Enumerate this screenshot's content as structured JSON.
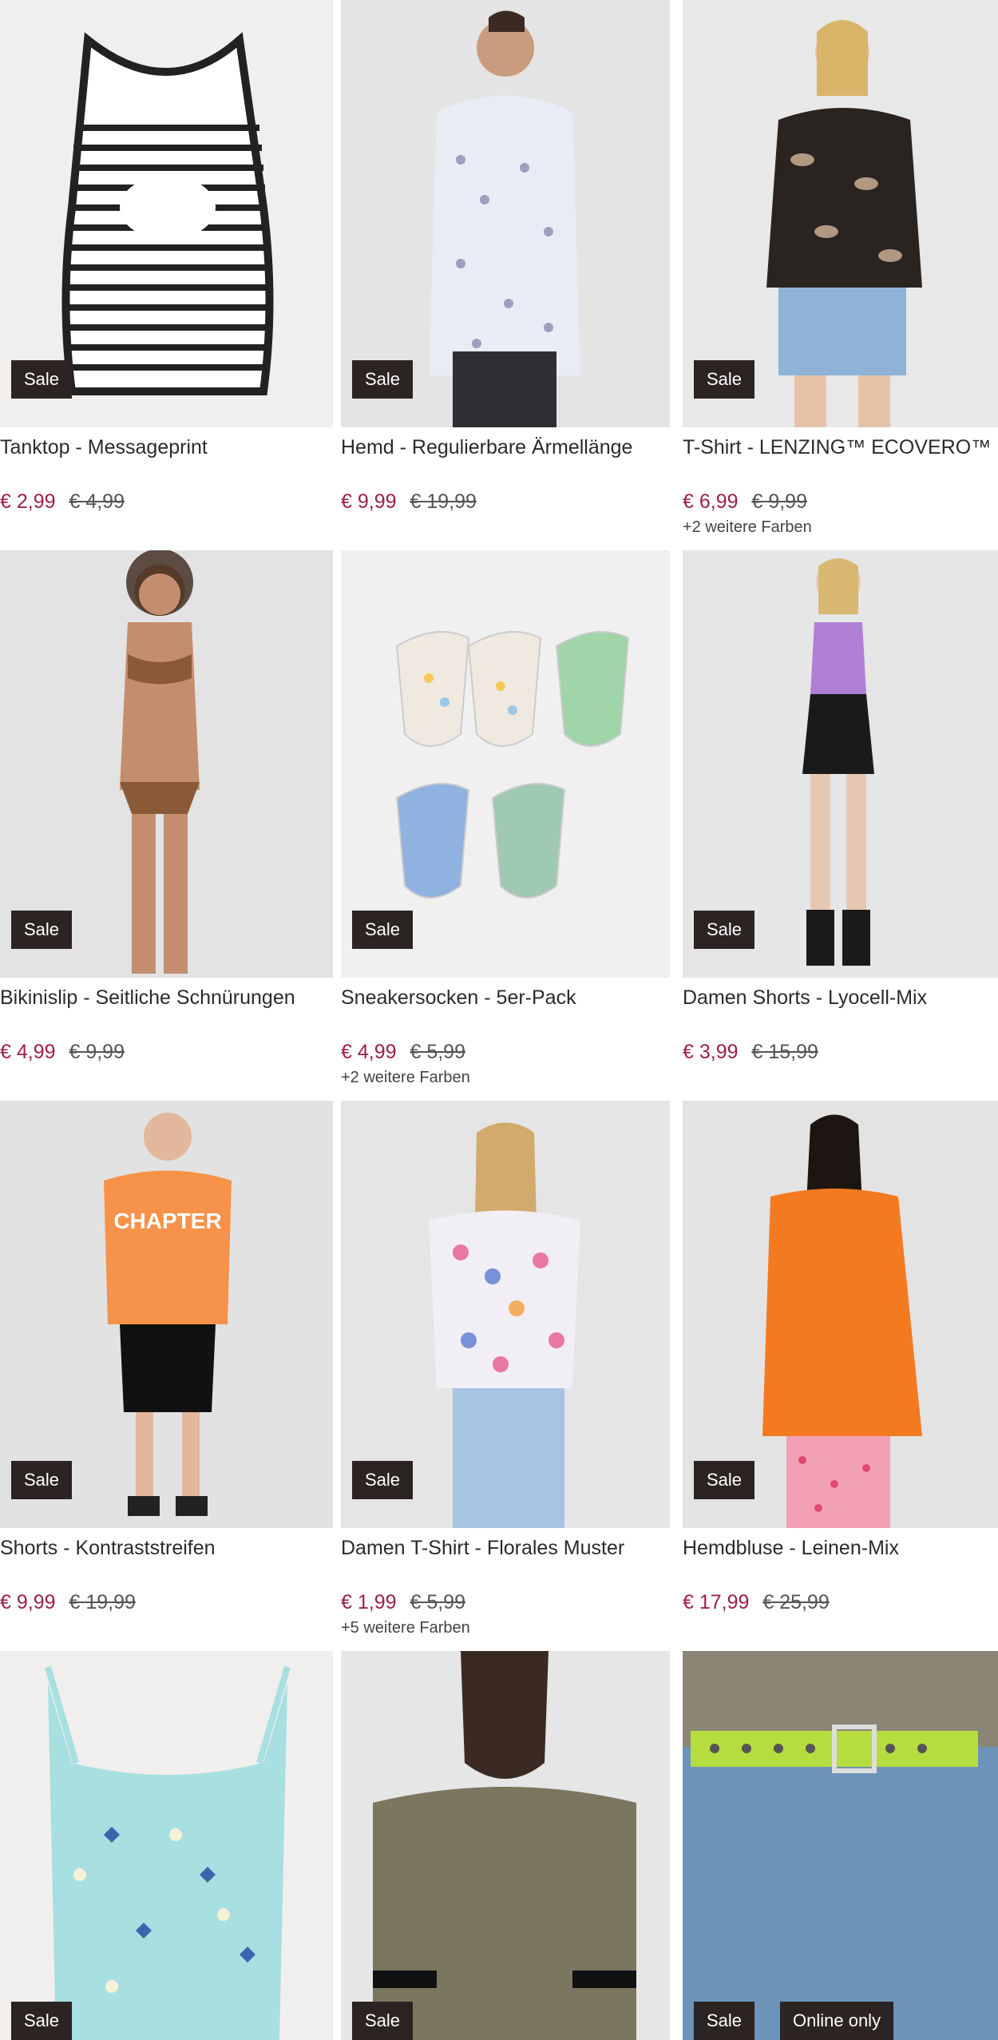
{
  "products": [
    {
      "title": "Tanktop - Messageprint",
      "price": "€ 2,99",
      "old_price": "€ 4,99",
      "badge": "Sale",
      "more_colors": "",
      "bg": "#f0efee"
    },
    {
      "title": "Hemd - Regulierbare Ärmellänge",
      "price": "€ 9,99",
      "old_price": "€ 19,99",
      "badge": "Sale",
      "more_colors": "",
      "bg": "#e4e4e4"
    },
    {
      "title": "T-Shirt - LENZING™ ECOVERO™",
      "price": "€ 6,99",
      "old_price": "€ 9,99",
      "badge": "Sale",
      "more_colors": "+2 weitere Farben",
      "bg": "#e8e8e8"
    },
    {
      "title": "Bikinislip - Seitliche Schnürungen",
      "price": "€ 4,99",
      "old_price": "€ 9,99",
      "badge": "Sale",
      "more_colors": "",
      "bg": "#e3e3e3"
    },
    {
      "title": "Sneakersocken - 5er-Pack",
      "price": "€ 4,99",
      "old_price": "€ 5,99",
      "badge": "Sale",
      "more_colors": "+2 weitere Farben",
      "bg": "#f0f0f0"
    },
    {
      "title": "Damen Shorts - Lyocell-Mix",
      "price": "€ 3,99",
      "old_price": "€ 15,99",
      "badge": "Sale",
      "more_colors": "",
      "bg": "#e6e6e6"
    },
    {
      "title": "Shorts - Kontraststreifen",
      "price": "€ 9,99",
      "old_price": "€ 19,99",
      "badge": "Sale",
      "more_colors": "",
      "bg": "#e2e2e2"
    },
    {
      "title": "Damen T-Shirt - Florales Muster",
      "price": "€ 1,99",
      "old_price": "€ 5,99",
      "badge": "Sale",
      "more_colors": "+5 weitere Farben",
      "bg": "#e5e5e5"
    },
    {
      "title": "Hemdbluse - Leinen-Mix",
      "price": "€ 17,99",
      "old_price": "€ 25,99",
      "badge": "Sale",
      "more_colors": "",
      "bg": "#e3e3e3"
    },
    {
      "title": "",
      "price": "",
      "old_price": "",
      "badge": "Sale",
      "more_colors": "",
      "bg": "#f0efee"
    },
    {
      "title": "",
      "price": "",
      "old_price": "",
      "badge": "Sale",
      "more_colors": "",
      "bg": "#e6e6e6"
    },
    {
      "title": "",
      "price": "",
      "old_price": "",
      "badge": "Sale",
      "online_badge": "Online only",
      "more_colors": "",
      "bg": "#cfcfcf"
    }
  ]
}
